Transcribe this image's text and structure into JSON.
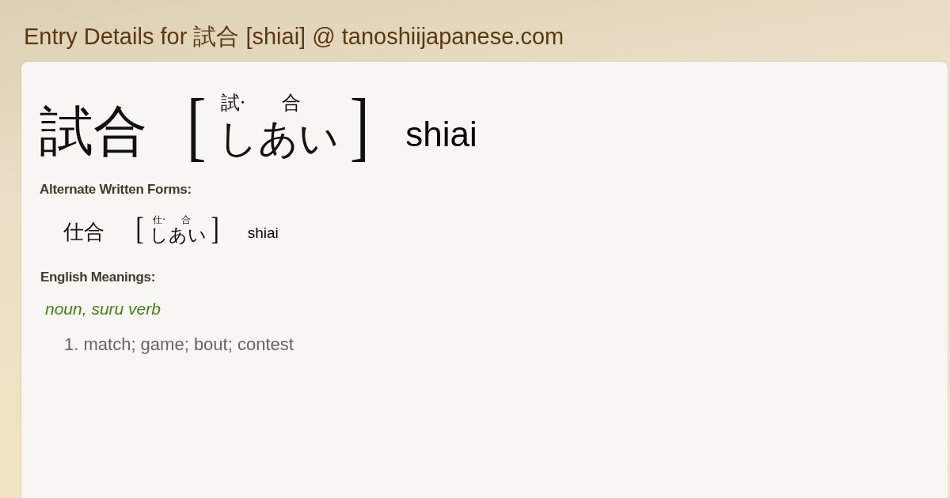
{
  "page_title": "Entry Details for 試合 [shiai] @ tanoshiijapanese.com",
  "entry": {
    "kanji": "試合",
    "open_bracket": "[",
    "furigana": [
      "試·",
      "合"
    ],
    "reading": "しあい",
    "close_bracket": "]",
    "romaji": "shiai"
  },
  "alternate_forms": {
    "heading": "Alternate Written Forms:",
    "items": [
      {
        "kanji": "仕合",
        "open_bracket": "[",
        "furigana": [
          "仕·",
          "合"
        ],
        "reading": "しあい",
        "close_bracket": "]",
        "romaji": "shiai"
      }
    ]
  },
  "meanings": {
    "heading": "English Meanings:",
    "part_of_speech": "noun, suru verb",
    "items": [
      {
        "number": "1.",
        "text": "match; game; bout; contest"
      }
    ]
  }
}
